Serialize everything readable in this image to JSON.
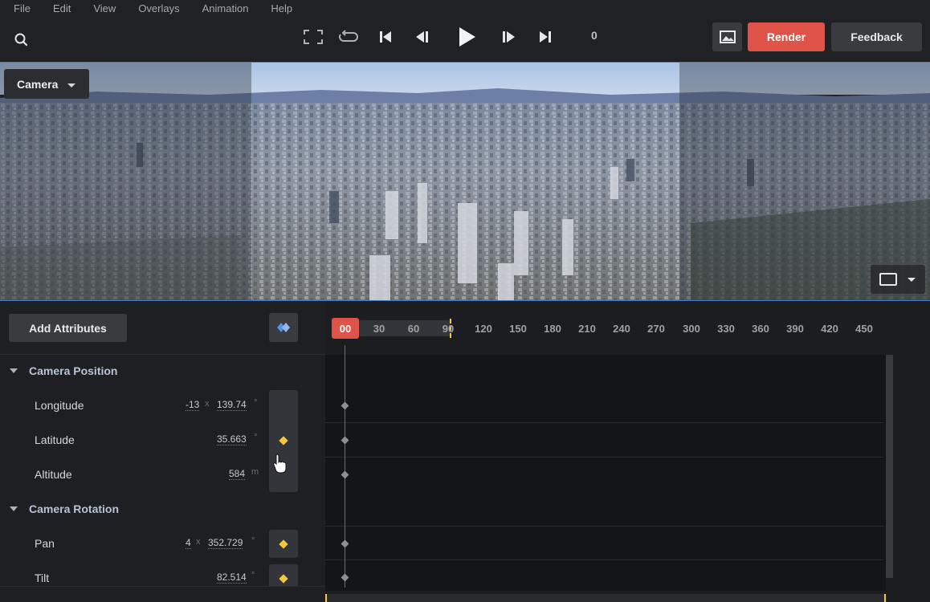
{
  "menu": [
    "File",
    "Edit",
    "View",
    "Overlays",
    "Animation",
    "Help"
  ],
  "transport": {
    "frame": "0",
    "icons": [
      "fullscreen-icon",
      "loop-icon",
      "skip-to-start-icon",
      "previous-keyframe-icon",
      "play-icon",
      "next-keyframe-icon",
      "skip-to-end-icon"
    ]
  },
  "toolbar": {
    "render_label": "Render",
    "feedback_label": "Feedback",
    "image_icon": "image-icon"
  },
  "viewport": {
    "camera_label": "Camera",
    "aspect_icon": "aspect-ratio-icon"
  },
  "attributes": {
    "add_label": "Add Attributes",
    "sections": [
      {
        "title": "Camera Position",
        "rows": [
          {
            "label": "Longitude",
            "value_a": "-13",
            "value_b": "139.74",
            "unit": "°"
          },
          {
            "label": "Latitude",
            "value": "35.663",
            "unit": "°"
          },
          {
            "label": "Altitude",
            "value": "584",
            "unit": "m"
          }
        ]
      },
      {
        "title": "Camera Rotation",
        "rows": [
          {
            "label": "Pan",
            "value_a": "4",
            "value_b": "352.729",
            "unit": "°"
          },
          {
            "label": "Tilt",
            "value": "82.514",
            "unit": "°"
          }
        ]
      }
    ],
    "x_sep": "x"
  },
  "timeline": {
    "current": "00",
    "ticks": [
      "30",
      "60",
      "90",
      "120",
      "150",
      "180",
      "210",
      "240",
      "270",
      "300",
      "330",
      "360",
      "390",
      "420",
      "450"
    ]
  },
  "colors": {
    "accent": "#e05349",
    "keyframe": "#f1c93a",
    "selection": "#4a78c4"
  }
}
